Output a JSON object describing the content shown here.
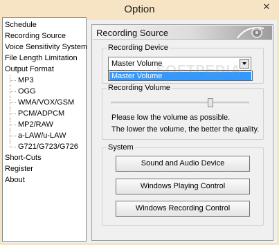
{
  "window": {
    "title": "Option",
    "close_glyph": "✕"
  },
  "tree": {
    "items": [
      {
        "label": "Schedule",
        "level": 0
      },
      {
        "label": "Recording Source",
        "level": 0
      },
      {
        "label": "Voice Sensitivity System",
        "level": 0
      },
      {
        "label": "File Length Limitation",
        "level": 0
      },
      {
        "label": "Output Format",
        "level": 0
      },
      {
        "label": "MP3",
        "level": 1
      },
      {
        "label": "OGG",
        "level": 1
      },
      {
        "label": "WMA/VOX/GSM",
        "level": 1
      },
      {
        "label": "PCM/ADPCM",
        "level": 1
      },
      {
        "label": "MP2/RAW",
        "level": 1
      },
      {
        "label": "a-LAW/u-LAW",
        "level": 1
      },
      {
        "label": "G721/G723/G726",
        "level": 1
      },
      {
        "label": "Short-Cuts",
        "level": 0
      },
      {
        "label": "Register",
        "level": 0
      },
      {
        "label": "About",
        "level": 0
      }
    ]
  },
  "panel": {
    "title": "Recording Source",
    "recording_device": {
      "legend": "Recording Device",
      "selected": "Master Volume",
      "options": [
        "Master Volume"
      ]
    },
    "recording_volume": {
      "legend": "Recording Volume",
      "level_fraction": 0.72,
      "note_line1": "Please low the volume as possible.",
      "note_line2": "The lower the volume, the better the quality."
    },
    "system": {
      "legend": "System",
      "buttons": [
        "Sound and Audio Device",
        "Windows Playing Control",
        "Windows Recording Control"
      ]
    }
  },
  "watermark": "SOFTPEDIA",
  "colors": {
    "title_bar": "#f6e4c4",
    "selection": "#3399ff"
  }
}
